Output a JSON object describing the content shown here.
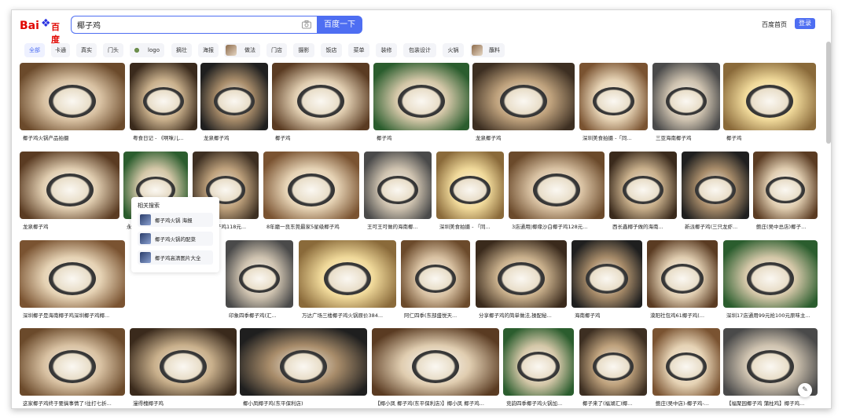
{
  "logo": {
    "bai": "Bai",
    "du": "百度"
  },
  "search": {
    "query": "椰子鸡",
    "button": "百度一下"
  },
  "header": {
    "home": "百度首页",
    "login": "登录"
  },
  "filters": [
    {
      "label": "全部",
      "active": true
    },
    {
      "label": "卡通"
    },
    {
      "label": "真实"
    },
    {
      "label": "门头"
    },
    {
      "label": "logo",
      "thumb": "logo"
    },
    {
      "label": "摘壮"
    },
    {
      "label": "海报"
    },
    {
      "label": "做法",
      "thumb": "dish"
    },
    {
      "label": "门店"
    },
    {
      "label": "摄影"
    },
    {
      "label": "饭店"
    },
    {
      "label": "菜单"
    },
    {
      "label": "装修"
    },
    {
      "label": "包装设计"
    },
    {
      "label": "火锅"
    },
    {
      "label": "蘸料",
      "thumb": "dish"
    }
  ],
  "rows": [
    [
      "椰子鸡火锅产品拍摄",
      "粤食日记 - 《啊咪儿...",
      "龙泉椰子鸡",
      "椰子鸡",
      "椰子鸡",
      "龙泉椰子鸡",
      "深圳美食拍摄 -「同...",
      "三亚海南椰子鸡",
      "椰子鸡"
    ],
    [
      "龙泉椰子鸡",
      "永汉椰子鸡,新鲜生态...",
      "盘泽园椰子鸡118元...",
      "8年磨一良东莞最家5星级椰子鸡",
      "王可王可做的海南椰...",
      "深圳美食拍摄 - 「同...",
      "3店通用|椰缘沙白椰子鸡128元...",
      "西长鑫椰子做的海南...",
      "新派椰子鸡(三只龙虾...",
      "鲍庄(吴中总店)椰子..."
    ],
    [
      "深圳椰子是海南椰子鸡深圳椰子鸡椰...",
      "印象四季椰子鸡(汇...",
      "万达广场三楼椰子鸡火锅原价384...",
      "阿仁四季(东部盛悦天...",
      "分享椰子鸡的简单做法,操配秘...",
      "海南椰子鸡",
      "漠阳社包鸡61椰子鸡(...",
      "深圳17店通用99元抢100元原味主..."
    ],
    [
      "这家椰子鸡终于要搞事情了!往打七折...",
      "漫得槐椰子鸡",
      "椰小凤椰子鸡(东平保利店)",
      "【椰小凤 椰子鸡(东平保利店)】椰小凤 椰子鸡...",
      "竞韵四季椰子鸡火锅加...",
      "椰子来了(福湖汇)椰...",
      "鲍庄(吴中店)-椰子鸡-...",
      "【福聚园椰子鸡 蒲柱鸡】椰子鸡..."
    ]
  ],
  "related": {
    "title": "相关搜索",
    "items": [
      "椰子鸡火锅 海报",
      "椰子鸡火锅的配菜",
      "椰子鸡高清图片大全"
    ]
  }
}
